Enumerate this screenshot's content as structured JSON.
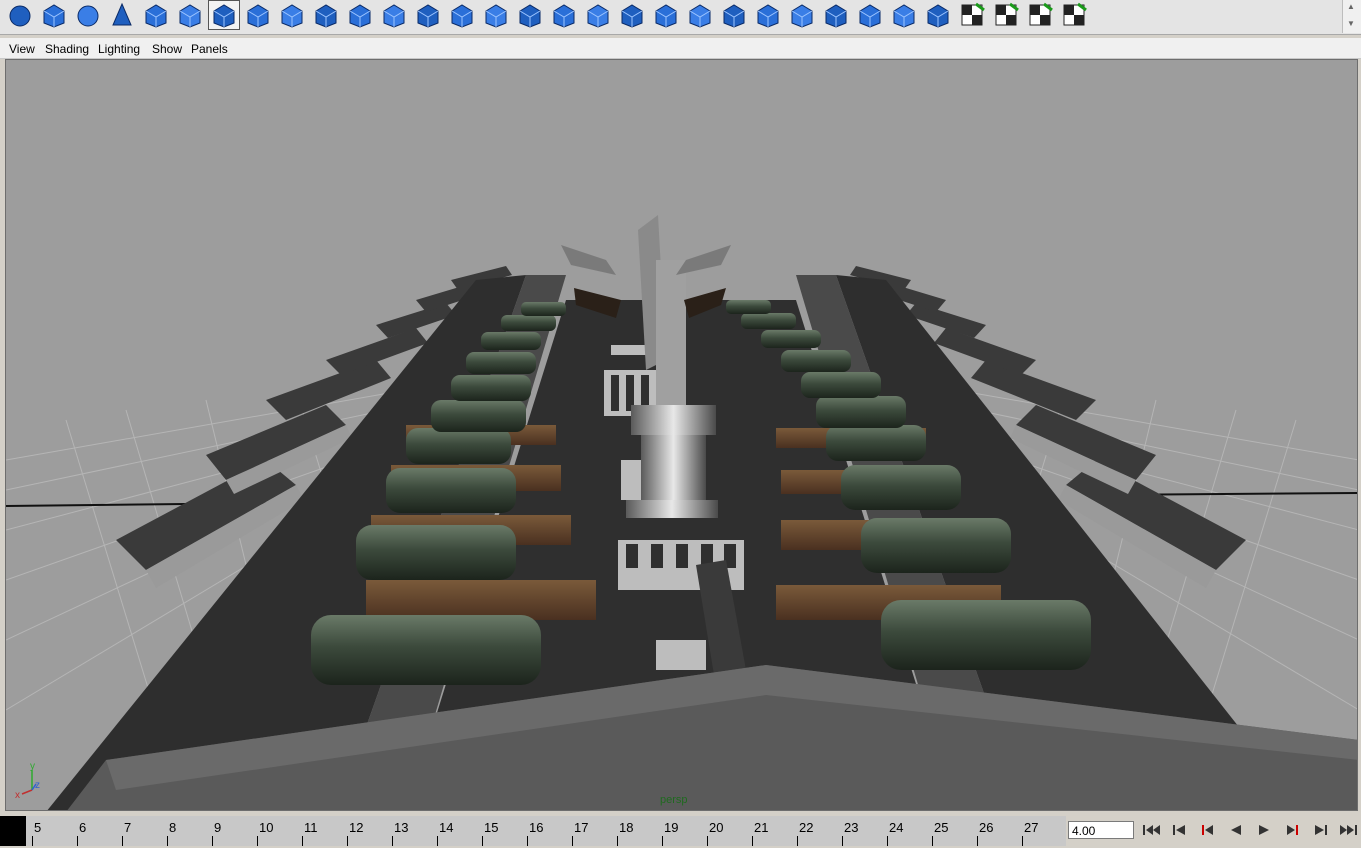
{
  "shelf": {
    "icons": [
      "poly-sphere-icon",
      "poly-cube-icon",
      "poly-cylinder-icon",
      "poly-cone-icon",
      "poly-plane-icon",
      "poly-torus-icon",
      "poly-prism-icon",
      "poly-helix-icon",
      "combine-icon",
      "separate-icon",
      "extract-icon",
      "smooth-icon",
      "boolean-icon",
      "reduce-icon",
      "fill-hole-icon",
      "append-polygon-icon",
      "split-polygon-icon",
      "extrude-face-icon",
      "extrude-edge-icon",
      "bridge-icon",
      "wedge-icon",
      "bevel-icon",
      "merge-icon",
      "poke-icon",
      "duplicate-face-icon",
      "collapse-icon",
      "soften-edge-icon",
      "uv-planar-icon",
      "uv-cylindrical-icon",
      "uv-spherical-icon",
      "uv-automatic-icon",
      "uv-editor-icon"
    ],
    "active_index": 6
  },
  "panel_menu": {
    "items": [
      {
        "label": "View",
        "name": "menu-view"
      },
      {
        "label": "Shading",
        "name": "menu-shading"
      },
      {
        "label": "Lighting",
        "name": "menu-lighting"
      },
      {
        "label": "Show",
        "name": "menu-show"
      },
      {
        "label": "Panels",
        "name": "menu-panels"
      }
    ]
  },
  "viewport": {
    "camera": "persp",
    "axis": {
      "y": "y",
      "x": "x",
      "z": "z"
    },
    "background_color": "#9d9d9d"
  },
  "timeline": {
    "ticks": [
      "5",
      "6",
      "7",
      "8",
      "9",
      "10",
      "11",
      "12",
      "13",
      "14",
      "15",
      "16",
      "17",
      "18",
      "19",
      "20",
      "21",
      "22",
      "23",
      "24",
      "25",
      "26",
      "27"
    ],
    "current_time": "4.00"
  },
  "playback": {
    "buttons": [
      {
        "name": "go-to-start-button",
        "icon": "go-to-start-icon"
      },
      {
        "name": "step-back-key-button",
        "icon": "step-back-key-icon"
      },
      {
        "name": "step-back-frame-button",
        "icon": "step-back-frame-icon"
      },
      {
        "name": "play-backwards-button",
        "icon": "play-backwards-icon"
      },
      {
        "name": "play-forwards-button",
        "icon": "play-forwards-icon"
      },
      {
        "name": "step-forward-frame-button",
        "icon": "step-forward-frame-icon"
      },
      {
        "name": "step-forward-key-button",
        "icon": "step-forward-key-icon"
      },
      {
        "name": "go-to-end-button",
        "icon": "go-to-end-icon"
      }
    ]
  },
  "colors": {
    "accent": "#1f5fbf",
    "camera_label": "#1f6a1f"
  }
}
